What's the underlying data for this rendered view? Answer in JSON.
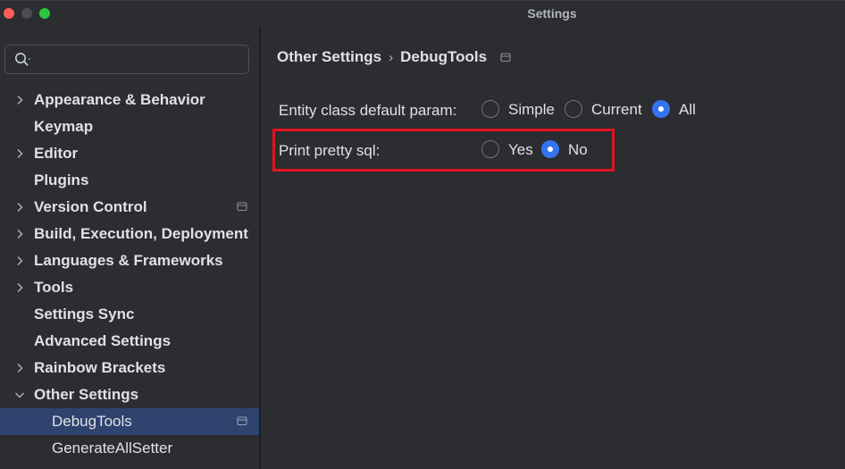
{
  "window": {
    "title": "Settings"
  },
  "search": {
    "placeholder": "",
    "value": ""
  },
  "sidebar": {
    "items": [
      {
        "label": "Appearance & Behavior",
        "expandable": true
      },
      {
        "label": "Keymap",
        "expandable": false
      },
      {
        "label": "Editor",
        "expandable": true
      },
      {
        "label": "Plugins",
        "expandable": false
      },
      {
        "label": "Version Control",
        "expandable": true,
        "project_icon": true
      },
      {
        "label": "Build, Execution, Deployment",
        "expandable": true
      },
      {
        "label": "Languages & Frameworks",
        "expandable": true
      },
      {
        "label": "Tools",
        "expandable": true
      },
      {
        "label": "Settings Sync",
        "expandable": false
      },
      {
        "label": "Advanced Settings",
        "expandable": false
      },
      {
        "label": "Rainbow Brackets",
        "expandable": true
      },
      {
        "label": "Other Settings",
        "expanded": true
      },
      {
        "label": "DebugTools",
        "selected": true,
        "project_icon": true
      },
      {
        "label": "GenerateAllSetter"
      }
    ]
  },
  "breadcrumb": {
    "parent": "Other Settings",
    "separator": "›",
    "current": "DebugTools"
  },
  "settings": {
    "entity_param": {
      "label": "Entity class default param:",
      "options": [
        "Simple",
        "Current",
        "All"
      ],
      "selected": "All"
    },
    "pretty_sql": {
      "label": "Print pretty sql:",
      "options": [
        "Yes",
        "No"
      ],
      "selected": "No"
    }
  },
  "colors": {
    "accent": "#3574f0",
    "selection": "#2e436e",
    "highlight_border": "#e3141f",
    "background": "#2b2d30"
  },
  "icons": [
    "search-icon",
    "chevron-right-icon",
    "chevron-down-icon",
    "project-settings-icon"
  ]
}
